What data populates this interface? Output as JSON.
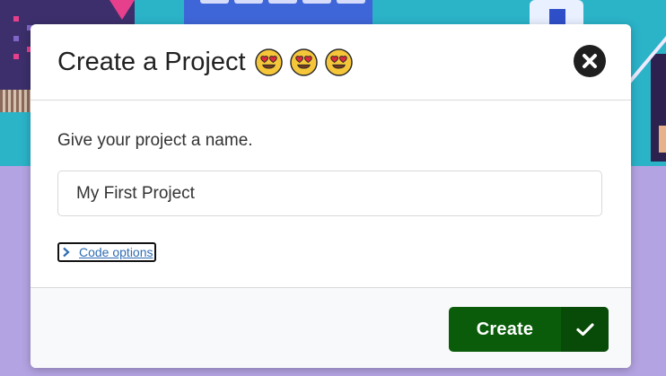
{
  "dialog": {
    "title": "Create a Project",
    "title_emojis": [
      "heart-eyes-emoji",
      "heart-eyes-emoji",
      "heart-eyes-emoji"
    ],
    "close_icon": "close-icon",
    "prompt": "Give your project a name.",
    "name_input": {
      "value": "My First Project",
      "placeholder": ""
    },
    "code_options_label": "Code options",
    "code_options_icon": "chevron-right-icon",
    "create_button": {
      "label": "Create",
      "icon": "check-icon"
    }
  },
  "colors": {
    "create_button": "#0a5c0a",
    "create_button_icon_area": "#084a08",
    "link": "#2f6db3",
    "close_button": "#1f1f1f",
    "backdrop_top": "#2bb3c8",
    "backdrop_bottom": "#b4a3e2"
  }
}
